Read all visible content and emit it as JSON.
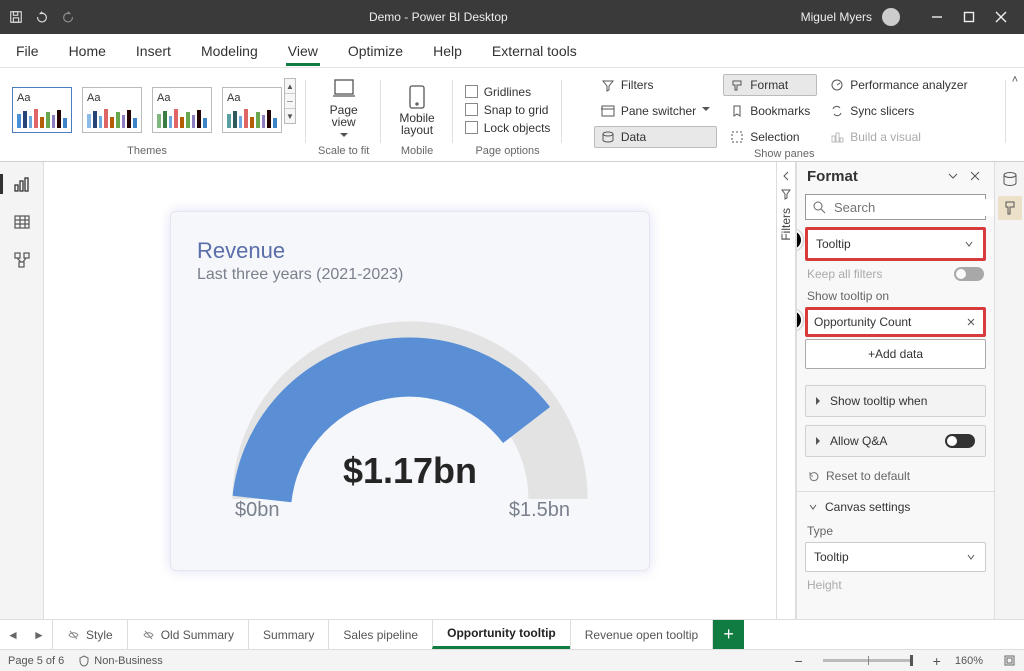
{
  "titlebar": {
    "title": "Demo - Power BI Desktop",
    "user": "Miguel Myers"
  },
  "menu": {
    "file": "File",
    "home": "Home",
    "insert": "Insert",
    "modeling": "Modeling",
    "view": "View",
    "optimize": "Optimize",
    "help": "Help",
    "external": "External tools"
  },
  "ribbon": {
    "groups": {
      "themes": "Themes",
      "scale": "Scale to fit",
      "mobile": "Mobile",
      "pageopts": "Page options",
      "panes": "Show panes"
    },
    "theme_aa": "Aa",
    "pageview": "Page\nview",
    "mobilelayout": "Mobile\nlayout",
    "gridlines": "Gridlines",
    "snap": "Snap to grid",
    "lock": "Lock objects",
    "filters": "Filters",
    "paneswitcher": "Pane switcher",
    "data": "Data",
    "format": "Format",
    "bookmarks": "Bookmarks",
    "selection": "Selection",
    "perf": "Performance analyzer",
    "sync": "Sync slicers",
    "build": "Build a visual"
  },
  "sidepane": {
    "filters_vert": "Filters",
    "title": "Format",
    "search_placeholder": "Search",
    "tooltip_dropdown": "Tooltip",
    "keep_all_filters": "Keep all filters",
    "show_tooltip_on": "Show tooltip on",
    "opportunity_count": "Opportunity Count",
    "add_data": "+Add data",
    "show_tooltip_when": "Show tooltip when",
    "allow_qa": "Allow Q&A",
    "reset": "Reset to default",
    "canvas_settings": "Canvas settings",
    "type_label": "Type",
    "type_value": "Tooltip",
    "height_label": "Height"
  },
  "visual": {
    "title": "Revenue",
    "subtitle": "Last three years (2021-2023)",
    "value": "$1.17bn",
    "min": "$0bn",
    "max": "$1.5bn"
  },
  "tabs": {
    "style": "Style",
    "old_summary": "Old Summary",
    "summary": "Summary",
    "sales_pipeline": "Sales pipeline",
    "opportunity_tooltip": "Opportunity tooltip",
    "revenue_open_tooltip": "Revenue open tooltip"
  },
  "status": {
    "page": "Page 5 of 6",
    "sensitivity": "Non-Business",
    "zoom": "160%"
  },
  "chart_data": {
    "type": "gauge",
    "title": "Revenue",
    "subtitle": "Last three years (2021-2023)",
    "value_label": "$1.17bn",
    "value": 1.17,
    "min": 0,
    "max": 1.5,
    "unit": "bn",
    "currency": "$",
    "fill_fraction": 0.78
  }
}
